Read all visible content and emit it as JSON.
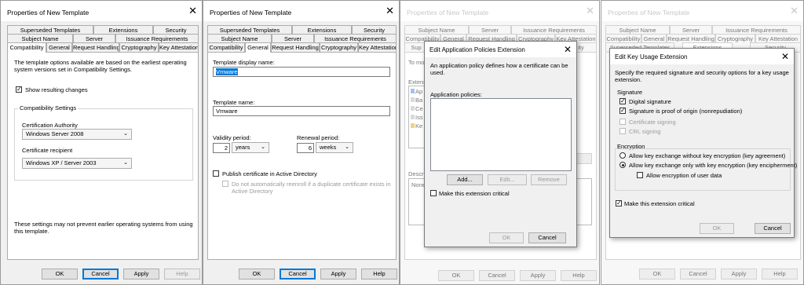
{
  "win1": {
    "title": "Properties of New Template",
    "tabs_row1": [
      "Superseded Templates",
      "Extensions",
      "Security"
    ],
    "tabs_row2": [
      "Subject Name",
      "Server",
      "Issuance Requirements"
    ],
    "tabs_row3": [
      "Compatibility",
      "General",
      "Request Handling",
      "Cryptography",
      "Key Attestation"
    ],
    "intro": "The template options available are based on the earliest operating system versions set in Compatibility Settings.",
    "show_changes": "Show resulting changes",
    "group_title": "Compatibility Settings",
    "ca_label": "Certification Authority",
    "ca_value": "Windows Server 2008",
    "recipient_label": "Certificate recipient",
    "recipient_value": "Windows XP / Server 2003",
    "footer": "These settings may not prevent earlier operating systems from using this template.",
    "buttons": [
      "OK",
      "Cancel",
      "Apply",
      "Help"
    ]
  },
  "win2": {
    "title": "Properties of New Template",
    "tabs_row1": [
      "Superseded Templates",
      "Extensions",
      "Security"
    ],
    "tabs_row2": [
      "Subject Name",
      "Server",
      "Issuance Requirements"
    ],
    "tabs_row3": [
      "Compatibility",
      "General",
      "Request Handling",
      "Cryptography",
      "Key Attestation"
    ],
    "display_name_label": "Template display name:",
    "display_name_value": "Vmware",
    "name_label": "Template name:",
    "name_value": "Vmware",
    "validity_label": "Validity period:",
    "validity_value": "2",
    "validity_unit": "years",
    "renewal_label": "Renewal period:",
    "renewal_value": "6",
    "renewal_unit": "weeks",
    "publish_label": "Publish certificate in Active Directory",
    "reenroll_label": "Do not automatically reenroll if a duplicate certificate exists in Active Directory",
    "buttons": [
      "OK",
      "Cancel",
      "Apply",
      "Help"
    ]
  },
  "win3": {
    "title": "Properties of New Template",
    "tabs_row1": [
      "Subject Name",
      "Server",
      "Issuance Requirements"
    ],
    "tabs_row2": [
      "Compatibility",
      "General",
      "Request Handling",
      "Cryptography",
      "Key Attestation"
    ],
    "tabs_row3": [
      "Sup",
      "ity"
    ],
    "frag_to": "To mo",
    "frag_ext": "Extens",
    "frag_items": [
      "Ap",
      "Ba",
      "Ce",
      "Iss",
      "Ke"
    ],
    "frag_desc": "Descri",
    "frag_none": "None",
    "buttons": [
      "OK",
      "Cancel",
      "Apply",
      "Help"
    ],
    "dialog": {
      "title": "Edit Application Policies Extension",
      "desc": "An application policy defines how a certificate can be used.",
      "list_label": "Application policies:",
      "add": "Add...",
      "edit": "Edit...",
      "remove": "Remove",
      "critical": "Make this extension critical",
      "ok": "OK",
      "cancel": "Cancel"
    }
  },
  "win4": {
    "title": "Properties of New Template",
    "tabs_row1": [
      "Subject Name",
      "Server",
      "Issuance Requirements"
    ],
    "tabs_row2": [
      "Compatibility",
      "General",
      "Request Handling",
      "Cryptography",
      "Key Attestation"
    ],
    "tabs_row3_left": "Superseded Templates",
    "tabs_row3_mid": "Extensions",
    "tabs_row3_right": "Security",
    "buttons": [
      "OK",
      "Cancel",
      "Apply",
      "Help"
    ],
    "dialog": {
      "title": "Edit Key Usage Extension",
      "desc": "Specify the required signature and security options for a key usage extension.",
      "sig_group": "Signature",
      "digital_signature": "Digital signature",
      "non_repudiation": "Signature is proof of origin (nonrepudiation)",
      "cert_signing": "Certificate signing",
      "crl_signing": "CRL signing",
      "enc_group": "Encryption",
      "enc_opt1": "Allow key exchange without key encryption (key agreement)",
      "enc_opt2": "Allow key exchange only with key encryption (key encipherment)",
      "enc_user_data": "Allow encryption of user data",
      "critical": "Make this extension critical",
      "ok": "OK",
      "cancel": "Cancel"
    }
  }
}
